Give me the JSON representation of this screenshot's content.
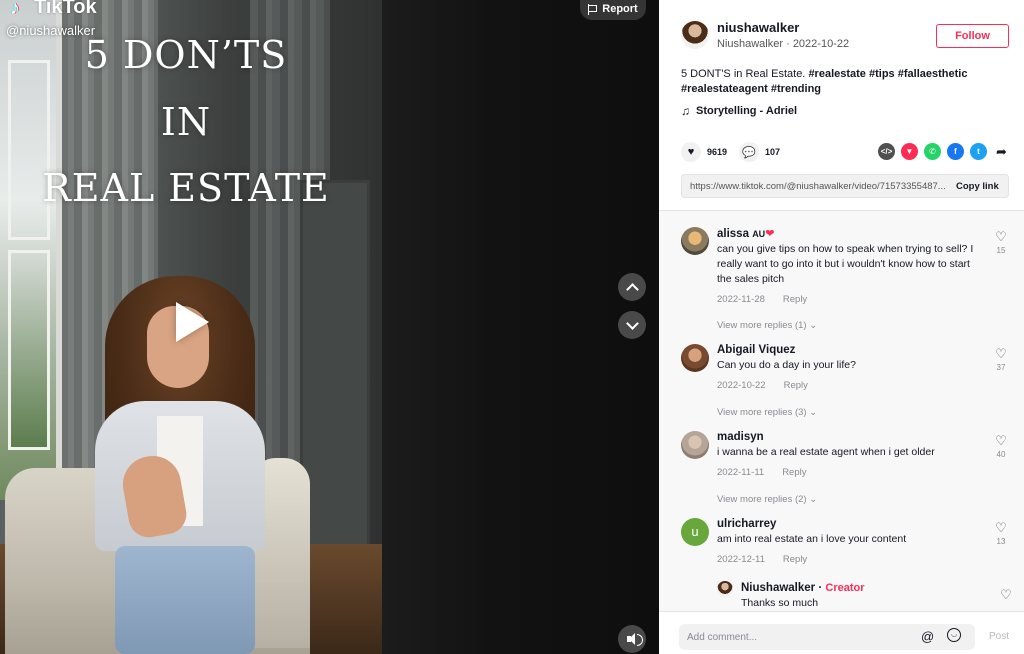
{
  "video": {
    "brand_name": "TikTok",
    "handle": "@niushawalker",
    "overlay_lines": [
      "5 DON’TS",
      "IN",
      "REAL ESTATE"
    ],
    "report_label": "Report"
  },
  "author": {
    "username": "niushawalker",
    "nickname": "Niushawalker",
    "separator": " · ",
    "date": "2022-10-22",
    "follow_label": "Follow"
  },
  "caption": {
    "text": "5 DONT'S in Real Estate. ",
    "hashtags": [
      "#realestate",
      "#tips",
      "#fallaesthetic",
      "#realestateagent",
      "#trending"
    ]
  },
  "music": {
    "title": "Storytelling - Adriel"
  },
  "stats": {
    "likes": "9619",
    "comments": "107"
  },
  "share": {
    "link": "https://www.tiktok.com/@niushawalker/video/71573355487...",
    "copy_label": "Copy link",
    "targets": [
      "embed-icon",
      "send-to-friends-icon",
      "whatsapp-icon",
      "facebook-icon",
      "twitter-icon",
      "share-arrow-icon"
    ]
  },
  "comments": [
    {
      "name": "alissa",
      "badge": "AU",
      "text": "can you give tips on how to speak when trying to sell? I really want to go into it but i wouldn't know how to start the sales pitch",
      "date": "2022-11-28",
      "reply_label": "Reply",
      "likes": "15",
      "more_replies": "View more replies (1)",
      "avatar_color": "#8a7a5e"
    },
    {
      "name": "Abigail Viquez",
      "badge": "",
      "text": "Can you do a day in your life?",
      "date": "2022-10-22",
      "reply_label": "Reply",
      "likes": "37",
      "more_replies": "View more replies (3)",
      "avatar_color": "#7a4a30"
    },
    {
      "name": "madisyn",
      "badge": "",
      "text": "i wanna be a real estate agent when i get older",
      "date": "2022-11-11",
      "reply_label": "Reply",
      "likes": "40",
      "more_replies": "View more replies (2)",
      "avatar_color": "#b5a497"
    },
    {
      "name": "ulricharrey",
      "badge": "",
      "avatar_letter": "u",
      "text": "am into real estate an i love your content",
      "date": "2022-12-11",
      "reply_label": "Reply",
      "likes": "13",
      "avatar_color": "#67a73b"
    }
  ],
  "reply": {
    "name": "Niushawalker",
    "creator_label": "Creator",
    "dot": " · ",
    "text": "Thanks so much"
  },
  "input": {
    "placeholder": "Add comment...",
    "post_label": "Post"
  },
  "colors": {
    "accent": "#fe2c55",
    "muted": "#8a8b91"
  }
}
